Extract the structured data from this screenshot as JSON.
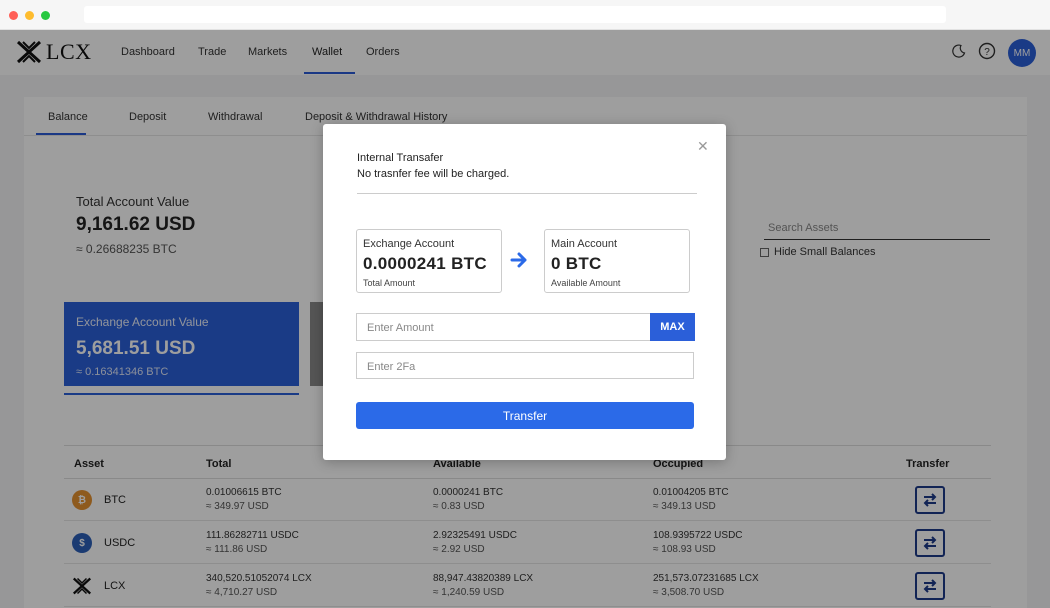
{
  "app": {
    "logo_text": "LCX"
  },
  "nav": {
    "items": [
      {
        "label": "Dashboard"
      },
      {
        "label": "Trade"
      },
      {
        "label": "Markets"
      },
      {
        "label": "Wallet"
      },
      {
        "label": "Orders"
      }
    ],
    "active": "Wallet",
    "avatar_initials": "MM"
  },
  "tabs": [
    {
      "label": "Balance"
    },
    {
      "label": "Deposit"
    },
    {
      "label": "Withdrawal"
    },
    {
      "label": "Deposit & Withdrawal History"
    }
  ],
  "summary": {
    "total_label": "Total Account Value",
    "total_usd": "9,161.62 USD",
    "total_btc": "≈ 0.26688235 BTC",
    "exchange_label": "Exchange Account Value",
    "exchange_usd": "5,681.51 USD",
    "exchange_btc": "≈ 0.16341346 BTC"
  },
  "search": {
    "placeholder": "Search Assets",
    "hide_small_label": "Hide Small Balances"
  },
  "table": {
    "headers": [
      "Asset",
      "Total",
      "Available",
      "Occupied",
      "Transfer"
    ],
    "rows": [
      {
        "asset": "BTC",
        "total": "0.01006615 BTC",
        "total_usd": "≈ 349.97 USD",
        "available": "0.0000241 BTC",
        "available_usd": "≈ 0.83 USD",
        "occupied": "0.01004205 BTC",
        "occupied_usd": "≈ 349.13 USD"
      },
      {
        "asset": "USDC",
        "total": "111.86282711 USDC",
        "total_usd": "≈ 111.86 USD",
        "available": "2.92325491 USDC",
        "available_usd": "≈ 2.92 USD",
        "occupied": "108.9395722 USDC",
        "occupied_usd": "≈ 108.93 USD"
      },
      {
        "asset": "LCX",
        "total": "340,520.51052074 LCX",
        "total_usd": "≈ 4,710.27 USD",
        "available": "88,947.43820389 LCX",
        "available_usd": "≈ 1,240.59 USD",
        "occupied": "251,573.07231685 LCX",
        "occupied_usd": "≈ 3,508.70 USD"
      }
    ]
  },
  "modal": {
    "title": "Internal Transafer",
    "subtitle": "No trasnfer fee will be charged.",
    "from_label": "Exchange Account",
    "from_value": "0.0000241 BTC",
    "from_sub": "Total Amount",
    "to_label": "Main Account",
    "to_value": "0 BTC",
    "to_sub": "Available Amount",
    "amount_placeholder": "Enter Amount",
    "max_label": "MAX",
    "twofa_placeholder": "Enter 2Fa",
    "transfer_label": "Transfer"
  },
  "colors": {
    "accent": "#2b5fd9",
    "overlay": "rgba(0,0,0,0.38)"
  }
}
